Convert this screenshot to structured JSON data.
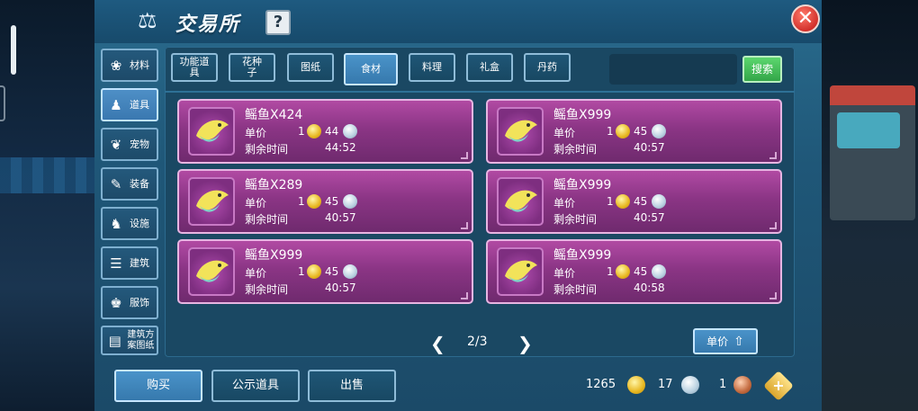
{
  "header": {
    "title": "交易所",
    "help_label": "?",
    "close_label": "✕"
  },
  "categories": [
    {
      "label": "材料",
      "icon": "material-icon",
      "glyph": "❀"
    },
    {
      "label": "道具",
      "icon": "item-icon",
      "glyph": "♟"
    },
    {
      "label": "宠物",
      "icon": "pet-icon",
      "glyph": "❦"
    },
    {
      "label": "装备",
      "icon": "equipment-icon",
      "glyph": "✎"
    },
    {
      "label": "设施",
      "icon": "facility-icon",
      "glyph": "♞"
    },
    {
      "label": "建筑",
      "icon": "building-icon",
      "glyph": "☰"
    },
    {
      "label": "服饰",
      "icon": "clothing-icon",
      "glyph": "♚"
    },
    {
      "label": "建筑方案图纸",
      "icon": "blueprint-icon",
      "glyph": "▤"
    }
  ],
  "active_category": "道具",
  "tabs": [
    {
      "label": "功能道具"
    },
    {
      "label": "花种子"
    },
    {
      "label": "图纸"
    },
    {
      "label": "食材"
    },
    {
      "label": "料理"
    },
    {
      "label": "礼盒"
    },
    {
      "label": "丹药"
    }
  ],
  "active_tab": "食材",
  "search": {
    "value": "",
    "button_label": "搜索"
  },
  "listing_labels": {
    "unit_price": "单价",
    "time_left": "剩余时间"
  },
  "listings": [
    {
      "name": "鳐鱼X424",
      "qty": "1",
      "price": "44",
      "time": "44:52"
    },
    {
      "name": "鳐鱼X999",
      "qty": "1",
      "price": "45",
      "time": "40:57"
    },
    {
      "name": "鳐鱼X289",
      "qty": "1",
      "price": "45",
      "time": "40:57"
    },
    {
      "name": "鳐鱼X999",
      "qty": "1",
      "price": "45",
      "time": "40:57"
    },
    {
      "name": "鳐鱼X999",
      "qty": "1",
      "price": "45",
      "time": "40:57"
    },
    {
      "name": "鳐鱼X999",
      "qty": "1",
      "price": "45",
      "time": "40:58"
    }
  ],
  "pager": {
    "text": "2/3",
    "prev": "❮",
    "next": "❯"
  },
  "sort_button": {
    "label": "单价",
    "icon": "arrow-up-icon"
  },
  "bottom_tabs": [
    {
      "label": "购买"
    },
    {
      "label": "公示道具"
    },
    {
      "label": "出售"
    }
  ],
  "active_bottom_tab": "购买",
  "currency": {
    "gold": "1265",
    "silver": "17",
    "copper": "1",
    "plus_label": "+"
  },
  "colors": {
    "window": "#1f5778",
    "listing_card": "#8b3585",
    "active_button": "#3a78b0",
    "search_button": "#33a649",
    "close_button": "#d2302b"
  }
}
